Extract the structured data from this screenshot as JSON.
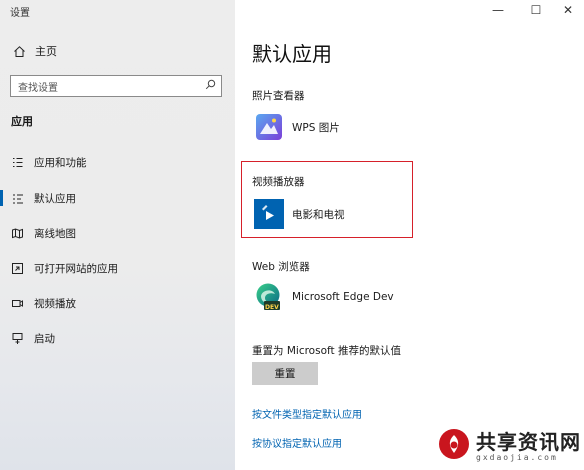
{
  "window": {
    "title": "设置",
    "controls": {
      "minimize": "—",
      "maximize": "☐",
      "close": "✕"
    }
  },
  "sidebar": {
    "home_label": "主页",
    "search_placeholder": "查找设置",
    "section_label": "应用",
    "items": [
      {
        "label": "应用和功能",
        "icon": "apps-list-icon",
        "selected": false
      },
      {
        "label": "默认应用",
        "icon": "default-apps-icon",
        "selected": true
      },
      {
        "label": "离线地图",
        "icon": "map-icon",
        "selected": false
      },
      {
        "label": "可打开网站的应用",
        "icon": "open-web-app-icon",
        "selected": false
      },
      {
        "label": "视频播放",
        "icon": "video-icon",
        "selected": false
      },
      {
        "label": "启动",
        "icon": "startup-icon",
        "selected": false
      }
    ]
  },
  "main": {
    "title": "默认应用",
    "photo_viewer": {
      "label": "照片查看器",
      "app": "WPS 图片"
    },
    "video_player": {
      "label": "视频播放器",
      "app": "电影和电视"
    },
    "web_browser": {
      "label": "Web 浏览器",
      "app": "Microsoft Edge Dev",
      "badge": "DEV"
    },
    "reset": {
      "label": "重置为 Microsoft 推荐的默认值",
      "button": "重置"
    },
    "links": [
      "按文件类型指定默认应用",
      "按协议指定默认应用"
    ]
  },
  "watermark": {
    "title": "共享资讯网",
    "url": "gxdaojia.com"
  },
  "colors": {
    "accent": "#0063b1",
    "highlight": "#d6202a",
    "sidebar_bg": "#ececec"
  }
}
